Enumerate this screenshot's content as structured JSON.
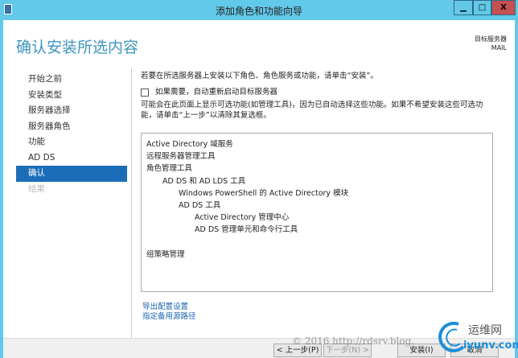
{
  "window": {
    "title": "添加角色和功能向导",
    "minimize": "▁",
    "maximize": "□",
    "close": "X"
  },
  "header": {
    "title": "确认安装所选内容",
    "target_label": "目标服务器",
    "target_value": "MAIL"
  },
  "nav": {
    "items": [
      {
        "label": "开始之前",
        "state": "normal"
      },
      {
        "label": "安装类型",
        "state": "normal"
      },
      {
        "label": "服务器选择",
        "state": "normal"
      },
      {
        "label": "服务器角色",
        "state": "normal"
      },
      {
        "label": "功能",
        "state": "normal"
      },
      {
        "label": "AD DS",
        "state": "normal"
      },
      {
        "label": "确认",
        "state": "selected"
      },
      {
        "label": "结果",
        "state": "disabled"
      }
    ]
  },
  "main": {
    "intro": "若要在所选服务器上安装以下角色、角色服务或功能，请单击“安装”。",
    "restart_label": "如果需要，自动重新启动目标服务器",
    "restart_checked": false,
    "note": "可能会在此页面上显示可选功能(如管理工具)，因为已自动选择这些功能。如果不希望安装这些可选功能，请单击“上一步”以清除其复选框。",
    "items": [
      {
        "text": "Active Directory 域服务",
        "level": 0
      },
      {
        "text": "远程服务器管理工具",
        "level": 0
      },
      {
        "text": "角色管理工具",
        "level": 1
      },
      {
        "text": "AD DS 和 AD LDS 工具",
        "level": 2
      },
      {
        "text": "Windows PowerShell 的 Active Directory 模块",
        "level": 3
      },
      {
        "text": "AD DS 工具",
        "level": 3
      },
      {
        "text": "Active Directory 管理中心",
        "level": 4
      },
      {
        "text": "AD DS 管理单元和命令行工具",
        "level": 4
      },
      {
        "text": "",
        "level": 0
      },
      {
        "text": "组策略管理",
        "level": 0
      }
    ],
    "export_link": "导出配置设置",
    "alt_source_link": "指定备用源路径"
  },
  "footer": {
    "prev": "< 上一步(P)",
    "next": "下一步(N) >",
    "install": "安装(I)",
    "cancel": "取消"
  },
  "watermark": "© 2016 http://rdsrv.blog.",
  "logo": {
    "text": "运维网",
    "domain": "iyunv.com"
  }
}
